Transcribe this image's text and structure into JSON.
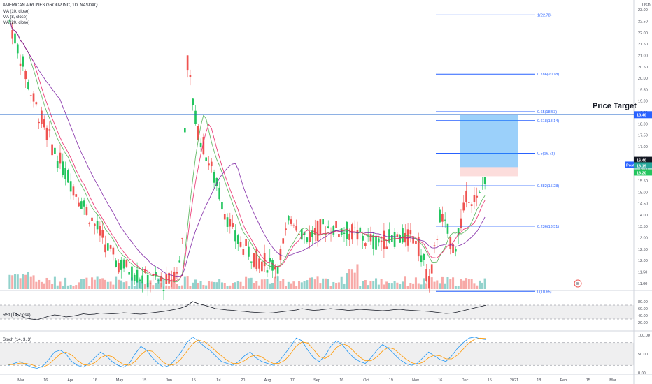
{
  "chart_data": {
    "type": "candlestick",
    "title": "AMERICAN AIRLINES GROUP INC, 1D, NASDAQ",
    "currency": "USD",
    "legend": [
      "MA (10, close)",
      "MA (8, close)",
      "MA (20, close)"
    ],
    "ma_colors": {
      "ma10": "#e91e63",
      "ma8": "#4caf50",
      "ma20": "#7b1fa2"
    },
    "x_ticks": [
      "Mar",
      "16",
      "Apr",
      "16",
      "May",
      "15",
      "Jun",
      "15",
      "Jul",
      "20",
      "Aug",
      "17",
      "Sep",
      "16",
      "Oct",
      "19",
      "Nov",
      "16",
      "Dec",
      "15",
      "2021",
      "18",
      "Feb",
      "15",
      "Mar"
    ],
    "y_ticks": [
      "11.00",
      "11.50",
      "12.00",
      "12.50",
      "13.00",
      "13.50",
      "14.00",
      "14.50",
      "15.00",
      "15.50",
      "16.00",
      "16.50",
      "17.00",
      "17.50",
      "18.00",
      "18.50",
      "19.00",
      "19.50",
      "20.00",
      "20.50",
      "21.00",
      "21.50",
      "22.00",
      "22.50",
      "23.00"
    ],
    "ylim": [
      10.75,
      23.25
    ],
    "fib_levels": [
      {
        "ratio": "1",
        "price": 22.78,
        "label": "1(22.78)"
      },
      {
        "ratio": "0.786",
        "price": 20.18,
        "label": "0.786(20.18)"
      },
      {
        "ratio": "0.65",
        "price": 18.53,
        "label": "0.65(18.53)"
      },
      {
        "ratio": "0.618",
        "price": 18.14,
        "label": "0.618(18.14)"
      },
      {
        "ratio": "0.5",
        "price": 16.71,
        "label": "0.5(16.71)"
      },
      {
        "ratio": "0.382",
        "price": 15.28,
        "label": "0.382(15.28)"
      },
      {
        "ratio": "0.236",
        "price": 13.51,
        "label": "0.236(13.51)"
      },
      {
        "ratio": "0",
        "price": 10.65,
        "label": "0(10.65)"
      }
    ],
    "price_target": {
      "label": "Price Target",
      "value": 18.4,
      "badge": "18.40"
    },
    "position": {
      "entry": 16.1,
      "target": 18.4,
      "stop": 15.7
    },
    "last_price": {
      "value": 16.19,
      "badge": "16.19",
      "post_label": "Post",
      "post_badge": "16.40",
      "prev_badge": "16.20"
    },
    "events": [
      "E"
    ],
    "rsi": {
      "title": "RSI (14, close)",
      "ticks": [
        "80.00",
        "60.00",
        "40.00",
        "20.00"
      ],
      "ylim": [
        0,
        100
      ],
      "bands": [
        30,
        70
      ],
      "values": [
        46,
        48,
        40,
        33,
        30,
        28,
        33,
        38,
        42,
        40,
        36,
        38,
        41,
        45,
        43,
        44,
        47,
        46,
        45,
        46,
        48,
        47,
        45,
        44,
        46,
        48,
        50,
        52,
        55,
        58,
        62,
        68,
        80,
        74,
        70,
        65,
        60,
        58,
        56,
        55,
        53,
        52,
        50,
        49,
        48,
        47,
        48,
        50,
        52,
        54,
        56,
        60,
        57,
        55,
        56,
        58,
        60,
        58,
        57,
        55,
        56,
        58,
        57,
        56,
        55,
        54,
        55,
        57,
        58,
        56,
        55,
        54,
        53,
        52,
        50,
        48,
        46,
        47,
        50,
        54,
        58,
        62,
        66,
        70
      ]
    },
    "stoch": {
      "title": "Stoch (14, 3, 3)",
      "ticks": [
        "100.00",
        "50.00",
        "0.00"
      ],
      "ylim": [
        0,
        100
      ],
      "bands": [
        20,
        80
      ],
      "k": [
        20,
        25,
        30,
        22,
        15,
        12,
        18,
        35,
        55,
        60,
        50,
        30,
        20,
        15,
        25,
        40,
        55,
        45,
        30,
        20,
        15,
        25,
        50,
        70,
        60,
        40,
        25,
        15,
        20,
        35,
        55,
        80,
        95,
        85,
        70,
        60,
        45,
        30,
        25,
        20,
        30,
        45,
        55,
        40,
        30,
        25,
        20,
        30,
        50,
        70,
        92,
        85,
        60,
        40,
        30,
        45,
        70,
        85,
        75,
        55,
        40,
        30,
        25,
        40,
        60,
        75,
        65,
        50,
        35,
        25,
        20,
        25,
        40,
        55,
        45,
        35,
        30,
        45,
        65,
        80,
        92,
        95,
        90,
        88
      ],
      "d": [
        22,
        22,
        26,
        25,
        22,
        16,
        15,
        22,
        36,
        50,
        55,
        47,
        33,
        22,
        20,
        27,
        40,
        47,
        43,
        32,
        22,
        20,
        30,
        48,
        60,
        57,
        42,
        27,
        20,
        23,
        37,
        57,
        77,
        87,
        83,
        72,
        58,
        45,
        33,
        25,
        25,
        32,
        43,
        47,
        42,
        32,
        25,
        25,
        33,
        50,
        71,
        82,
        79,
        62,
        43,
        38,
        48,
        67,
        77,
        72,
        57,
        42,
        32,
        32,
        42,
        58,
        67,
        63,
        50,
        37,
        27,
        23,
        28,
        40,
        47,
        45,
        37,
        37,
        47,
        63,
        79,
        89,
        92,
        91
      ]
    }
  }
}
